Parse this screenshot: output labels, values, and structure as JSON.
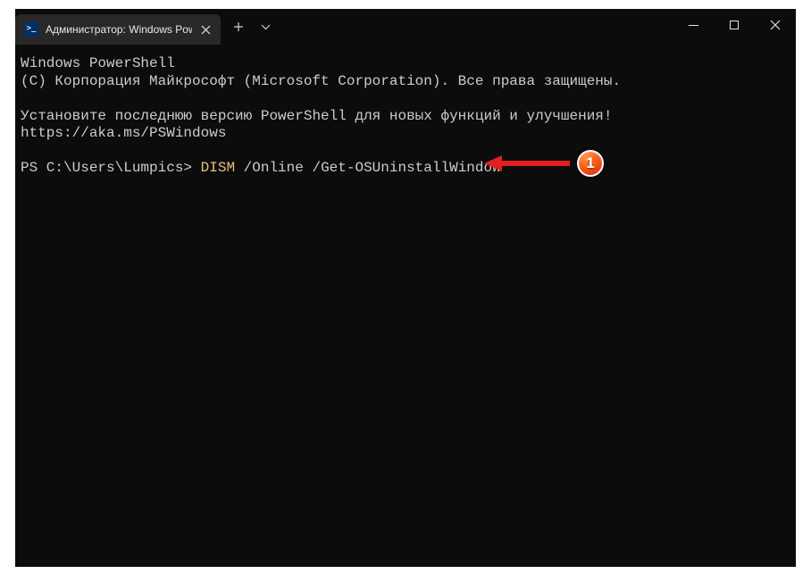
{
  "window": {
    "tab_title": "Администратор: Windows Pow",
    "icon_label": ">_"
  },
  "terminal": {
    "line1": "Windows PowerShell",
    "line2": "(C) Корпорация Майкрософт (Microsoft Corporation). Все права защищены.",
    "line3": "Установите последнюю версию PowerShell для новых функций и улучшения! https://aka.ms/PSWindows",
    "prompt": "PS C:\\Users\\Lumpics> ",
    "command_highlight": "DISM",
    "command_rest": " /Online /Get-OSUninstallWindow"
  },
  "annotation": {
    "number": "1"
  }
}
